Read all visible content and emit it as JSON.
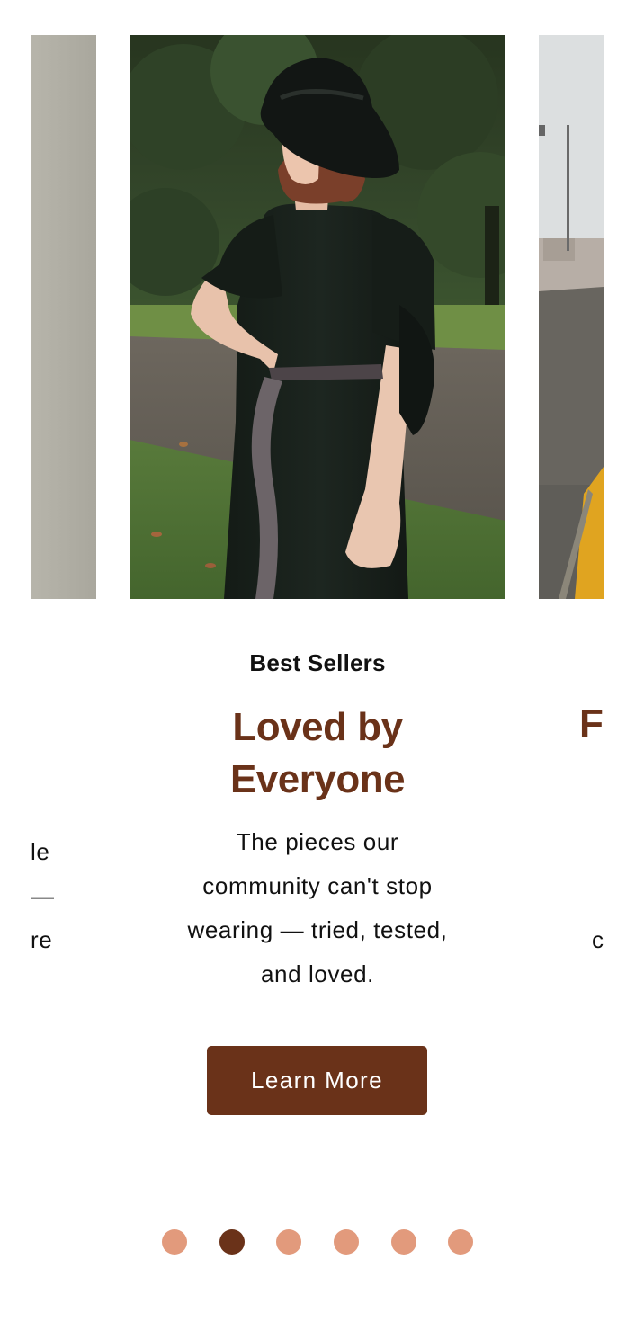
{
  "slides": [
    {
      "eyebrow": "",
      "headline": "",
      "description": "le\n—\nre"
    },
    {
      "eyebrow": "Best Sellers",
      "headline": "Loved by\nEveryone",
      "description": "The pieces our\ncommunity can't stop\nwearing — tried, tested,\nand loved.",
      "cta_label": "Learn More"
    },
    {
      "eyebrow": "",
      "headline": "F",
      "description": "\n\nc"
    }
  ],
  "carousel": {
    "slide_count": 6,
    "active_index": 1
  },
  "colors": {
    "accent": "#6a3219",
    "dot_inactive": "#e29a7c",
    "background": "#ffffff"
  }
}
